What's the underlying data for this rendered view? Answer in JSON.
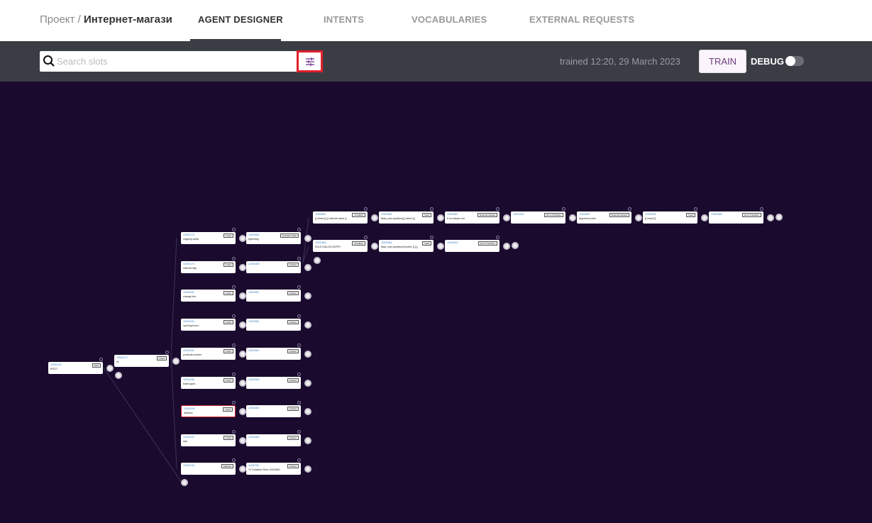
{
  "header": {
    "breadcrumb_project": "Проект",
    "breadcrumb_sep": "/",
    "breadcrumb_name": "Интернет-магази",
    "tabs": [
      {
        "label": "AGENT DESIGNER",
        "active": true
      },
      {
        "label": "INTENTS"
      },
      {
        "label": "VOCABULARIES"
      },
      {
        "label": "EXTERNAL REQUESTS"
      }
    ]
  },
  "toolbar": {
    "search_placeholder": "Search slots",
    "search_value": "",
    "search_icon": "search-icon",
    "filter_icon": "sliders-icon",
    "trained": "trained 12:20, 29 March 2023",
    "train_label": "TRAIN",
    "debug_label": "DEBUG",
    "debug_on": false
  },
  "colors": {
    "canvas": "#1a0b2e",
    "toolbar": "#3b3d44",
    "accent": "#6a3d7a",
    "highlight": "#e0202a"
  },
  "nodes": [
    {
      "id": "10002149",
      "label": "ROOT",
      "badge": "Start"
    },
    {
      "id": "10002170",
      "label": "Hi",
      "badge": "Intent"
    },
    {
      "id": "10002175",
      "label": "shipping.week",
      "badge": "Intent"
    },
    {
      "id": "10002176",
      "label": "internet.help",
      "badge": "Intent"
    },
    {
      "id": "10002180",
      "label": "change.info",
      "badge": "Intent"
    },
    {
      "id": "10002182",
      "label": "opening.hours",
      "badge": "Intent"
    },
    {
      "id": "10002184",
      "label": "products.number",
      "badge": "Intent"
    },
    {
      "id": "10002186",
      "label": "trade.types",
      "badge": "Intent"
    },
    {
      "id": "10002190",
      "label": "address",
      "badge": "Intent",
      "selected": true
    },
    {
      "id": "10002192",
      "label": "size",
      "badge": "Intent"
    },
    {
      "id": "10002193",
      "label": "",
      "badge": "Fallback"
    },
    {
      "id": "10002660",
      "label": "#greeting",
      "badge": "Transition Rule"
    },
    {
      "id": "10002655",
      "label": "",
      "badge": "Answer"
    },
    {
      "id": "10002657",
      "label": "",
      "badge": "Answer"
    },
    {
      "id": "10002651",
      "label": "",
      "badge": "Answer"
    },
    {
      "id": "10002667",
      "label": "",
      "badge": "Answer"
    },
    {
      "id": "10002662",
      "label": "",
      "badge": "Answer"
    },
    {
      "id": "10002663",
      "label": "",
      "badge": "Answer"
    },
    {
      "id": "10002664",
      "label": "",
      "badge": "Answer"
    },
    {
      "id": "11100700",
      "label": "To Transition Rule 10002660",
      "badge": "Answer"
    },
    {
      "id": "10002661",
      "label": "{{ Intent }} {{ Internet.name }}",
      "badge": "Condition"
    },
    {
      "id": "10002662",
      "label": "$ask_user.question({{ Intent }})",
      "badge": "Input"
    },
    {
      "id": "10002667",
      "label": "If no answer set",
      "badge": "External request"
    },
    {
      "id": "10002441",
      "label": "",
      "badge": "Go to Transition"
    },
    {
      "id": "10002487",
      "label": "argument.order",
      "badge": "External request"
    },
    {
      "id": "10002455",
      "label": "{{ result }}",
      "badge": "Input"
    },
    {
      "id": "10002489",
      "label": "",
      "badge": "Go to Transition"
    },
    {
      "id": "10002663",
      "label": "RULE.DIALOG.ENTRY",
      "badge": "Condition"
    },
    {
      "id": "10002664",
      "label": "$ask_user.question(Number {{ }})",
      "badge": "Input"
    },
    {
      "id": "10002644",
      "label": "",
      "badge": "Go to Transition"
    }
  ]
}
